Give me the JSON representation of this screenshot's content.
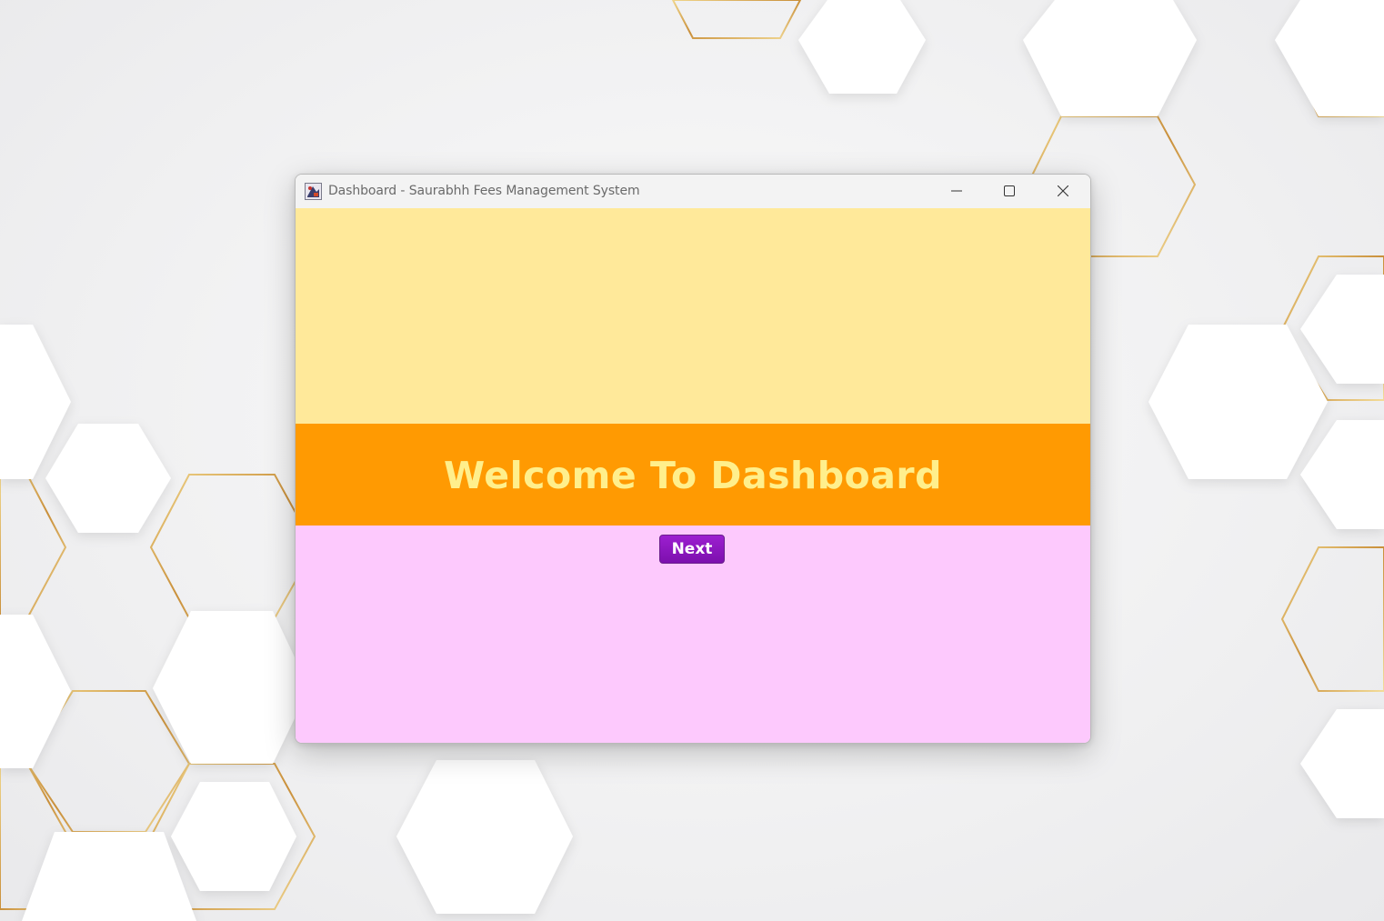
{
  "window": {
    "title": "Dashboard - Saurabhh Fees Management System",
    "app_icon": "java-app-icon",
    "controls": {
      "minimize_icon": "minimize-icon",
      "maximize_icon": "maximize-icon",
      "close_icon": "close-icon"
    }
  },
  "dashboard": {
    "welcome_text": "Welcome To Dashboard",
    "next_label": "Next"
  },
  "colors": {
    "top_panel": "#ffe99a",
    "banner": "#ff9a02",
    "banner_text": "#ffef8c",
    "bottom_panel": "#fdc9fd",
    "next_button": "#8a16bf",
    "wallpaper_accent": "#d9b15a"
  }
}
